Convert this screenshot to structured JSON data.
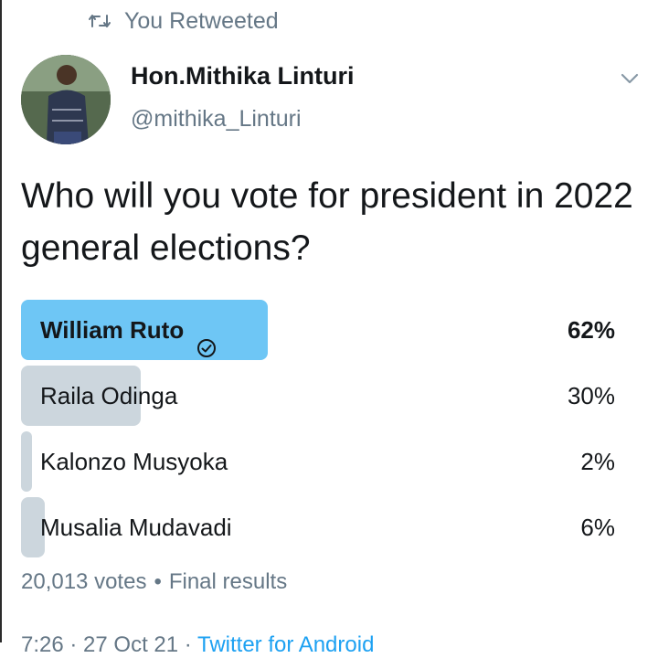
{
  "retweet": {
    "label": "You Retweeted",
    "icon": "retweet-icon"
  },
  "author": {
    "name": "Hon.Mithika Linturi",
    "handle": "@mithika_Linturi"
  },
  "tweet": {
    "text": "Who will you vote for president in 2022 general elections?"
  },
  "poll": {
    "options": [
      {
        "label": "William Ruto",
        "percent_text": "62%",
        "percent": 62,
        "winner": true
      },
      {
        "label": "Raila Odinga",
        "percent_text": "30%",
        "percent": 30,
        "winner": false
      },
      {
        "label": "Kalonzo Musyoka",
        "percent_text": "2%",
        "percent": 2,
        "winner": false
      },
      {
        "label": "Musalia Mudavadi",
        "percent_text": "6%",
        "percent": 6,
        "winner": false
      }
    ],
    "votes": "20,013 votes",
    "separator": "•",
    "status": "Final results"
  },
  "meta": {
    "time_date": "7:26 · 27 Oct 21 ·",
    "client": "Twitter for Android"
  },
  "colors": {
    "winner_bar": "#6ec6f5",
    "other_bar": "#ccd6dd",
    "text": "#14171a",
    "secondary": "#657786",
    "link": "#1da1f2"
  }
}
